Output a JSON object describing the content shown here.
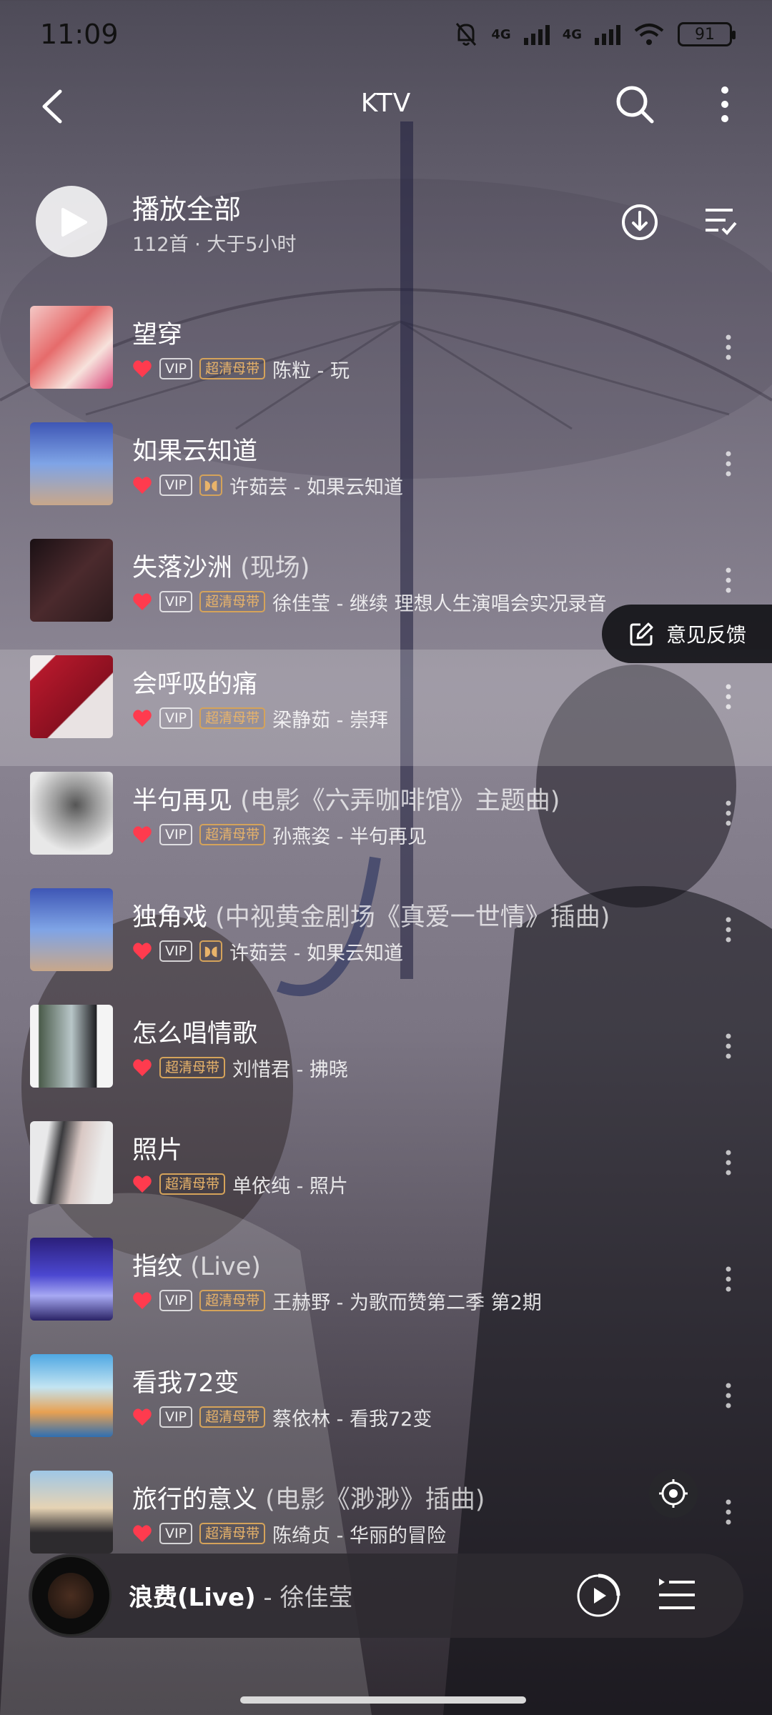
{
  "status_bar": {
    "time": "11:09",
    "network1": "4G",
    "network2": "4G",
    "battery": "91"
  },
  "header": {
    "title": "KTV"
  },
  "play_all": {
    "label": "播放全部",
    "meta": "112首 · 大于5小时"
  },
  "songs": [
    {
      "title": "望穿",
      "subtitle": "",
      "badges": [
        "VIP",
        "超清母带"
      ],
      "artist_album": "陈粒 - 玩"
    },
    {
      "title": "如果云知道",
      "subtitle": "",
      "badges": [
        "VIP",
        "dolby"
      ],
      "artist_album": "许茹芸 - 如果云知道"
    },
    {
      "title": "失落沙洲",
      "subtitle": " (现场)",
      "badges": [
        "VIP",
        "超清母带"
      ],
      "artist_album": "徐佳莹 - 继续 理想人生演唱会实况录音"
    },
    {
      "title": "会呼吸的痛",
      "subtitle": "",
      "badges": [
        "VIP",
        "超清母带"
      ],
      "artist_album": "梁静茹 - 崇拜"
    },
    {
      "title": "半句再见",
      "subtitle": " (电影《六弄咖啡馆》主题曲)",
      "badges": [
        "VIP",
        "超清母带"
      ],
      "artist_album": "孙燕姿 - 半句再见"
    },
    {
      "title": "独角戏",
      "subtitle": " (中视黄金剧场《真爱一世情》插曲)",
      "badges": [
        "VIP",
        "dolby"
      ],
      "artist_album": "许茹芸 - 如果云知道"
    },
    {
      "title": "怎么唱情歌",
      "subtitle": "",
      "badges": [
        "超清母带"
      ],
      "artist_album": "刘惜君 - 拂晓"
    },
    {
      "title": "照片",
      "subtitle": "",
      "badges": [
        "超清母带"
      ],
      "artist_album": "单依纯 - 照片"
    },
    {
      "title": "指纹",
      "subtitle": " (Live)",
      "badges": [
        "VIP",
        "超清母带"
      ],
      "artist_album": "王赫野 - 为歌而赞第二季 第2期"
    },
    {
      "title": "看我72变",
      "subtitle": "",
      "badges": [
        "VIP",
        "超清母带"
      ],
      "artist_album": "蔡依林 - 看我72变"
    },
    {
      "title": "旅行的意义",
      "subtitle": " (电影《渺渺》插曲)",
      "badges": [
        "VIP",
        "超清母带"
      ],
      "artist_album": "陈绮贞 - 华丽的冒险"
    }
  ],
  "feedback": {
    "label": "意见反馈"
  },
  "mini_player": {
    "song": "浪费(Live)",
    "separator": " - ",
    "artist": "徐佳莹"
  },
  "colors": {
    "heart": "#ff3b4e",
    "gold_badge": "#e8b36a"
  }
}
